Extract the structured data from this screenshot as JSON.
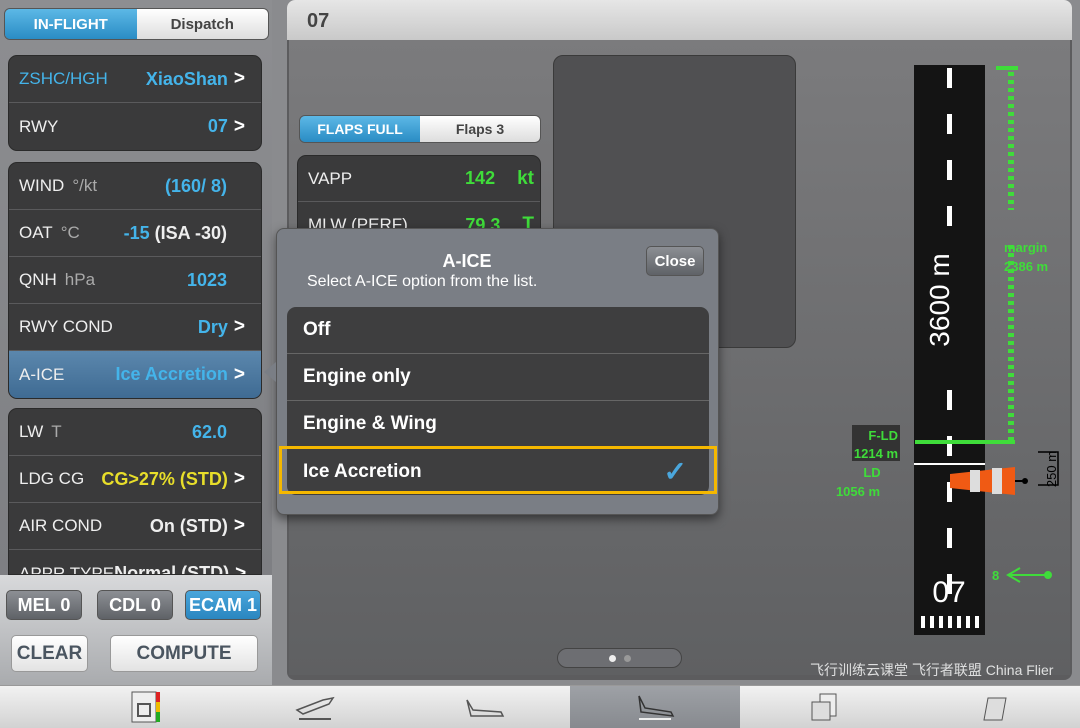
{
  "mode_toggle": {
    "options": [
      "IN-FLIGHT",
      "Dispatch"
    ],
    "selected": "IN-FLIGHT"
  },
  "airport": {
    "code": "ZSHC/HGH",
    "name": "XiaoShan"
  },
  "runway": {
    "label": "RWY",
    "value": "07"
  },
  "conditions": [
    {
      "label": "WIND",
      "unit": "°/kt",
      "value": "(160/ 8)"
    },
    {
      "label": "OAT",
      "unit": "°C",
      "value": "-15",
      "extra": "(ISA -30)"
    },
    {
      "label": "QNH",
      "unit": "hPa",
      "value": "1023"
    },
    {
      "label": "RWY COND",
      "value": "Dry"
    },
    {
      "label": "A-ICE",
      "value": "Ice Accretion"
    }
  ],
  "weights": [
    {
      "label": "LW",
      "unit": "T",
      "value": "62.0"
    },
    {
      "label": "LDG CG",
      "value": "CG>27% (STD)"
    },
    {
      "label": "AIR COND",
      "value": "On (STD)"
    },
    {
      "label": "APPR TYPE",
      "value": "Normal (STD)"
    }
  ],
  "counters": {
    "mel": "MEL 0",
    "cdl": "CDL 0",
    "ecam": "ECAM 1"
  },
  "actions": {
    "clear": "CLEAR",
    "compute": "COMPUTE"
  },
  "header": {
    "title": "07"
  },
  "flaps": {
    "options": [
      "FLAPS FULL",
      "Flaps 3"
    ],
    "selected": "FLAPS FULL"
  },
  "results": [
    {
      "label": "VAPP",
      "value": "142",
      "unit": "kt"
    },
    {
      "label": "MLW (PERF)",
      "value": "79.3",
      "unit": "T"
    }
  ],
  "dialog": {
    "title": "A-ICE",
    "subtitle": "Select A-ICE option from the list.",
    "close": "Close",
    "options": [
      "Off",
      "Engine only",
      "Engine & Wing",
      "Ice Accretion"
    ],
    "selected": "Ice Accretion"
  },
  "runway_diagram": {
    "length": "3600 m",
    "designator": "07",
    "margin_label": "margin",
    "margin": "2386 m",
    "fld_label": "F-LD",
    "fld": "1214 m",
    "ld_label": "LD",
    "ld": "1056 m",
    "scale": "250 m",
    "wind_component": "8"
  },
  "pager": {
    "pages": 2,
    "current": 1
  },
  "tabs": [
    "eqrh-icon",
    "takeoff-icon",
    "inflight-icon",
    "landing-icon",
    "documents-icon",
    "loadsheet-icon"
  ],
  "selected_tab": 3,
  "watermark": "飞行训练云课堂 飞行者联盟 China Flier",
  "colors": {
    "accent": "#2a8cc4",
    "green": "#3fdc3a",
    "yellow": "#e8de2a",
    "highlight": "#f5b800"
  }
}
